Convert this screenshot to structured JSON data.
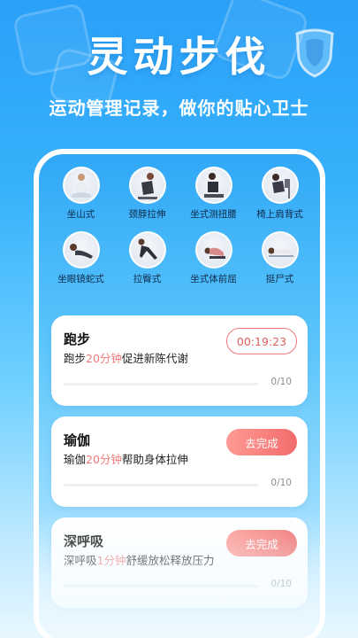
{
  "hero": {
    "title": "灵动步伐",
    "subtitle": "运动管理记录，做你的贴心卫士"
  },
  "poses": [
    {
      "label": "坐山式",
      "icon": "sitting-mountain-pose-icon"
    },
    {
      "label": "颈脖拉伸",
      "icon": "neck-stretch-pose-icon"
    },
    {
      "label": "坐式测扭腰",
      "icon": "seated-twist-pose-icon"
    },
    {
      "label": "椅上肩背式",
      "icon": "chair-shoulder-pose-icon"
    },
    {
      "label": "坐眼镜蛇式",
      "icon": "cobra-pose-icon"
    },
    {
      "label": "拉臀式",
      "icon": "hip-stretch-pose-icon"
    },
    {
      "label": "坐式体前屈",
      "icon": "forward-bend-pose-icon"
    },
    {
      "label": "挺尸式",
      "icon": "corpse-pose-icon"
    }
  ],
  "tasks": [
    {
      "title": "跑步",
      "desc_prefix": "跑步",
      "desc_highlight": "20分钟",
      "desc_suffix": "促进新陈代谢",
      "action_label": "00:19:23",
      "action_type": "timer",
      "progress_text": "0/10",
      "progress_fraction": 0
    },
    {
      "title": "瑜伽",
      "desc_prefix": "瑜伽",
      "desc_highlight": "20分钟",
      "desc_suffix": "帮助身体拉伸",
      "action_label": "去完成",
      "action_type": "button",
      "progress_text": "0/10",
      "progress_fraction": 0
    },
    {
      "title": "深呼吸",
      "desc_prefix": "深呼吸",
      "desc_highlight": "1分钟",
      "desc_suffix": "舒缓放松释放压力",
      "action_label": "去完成",
      "action_type": "button",
      "progress_text": "0/10",
      "progress_fraction": 0
    }
  ],
  "colors": {
    "accent": "#f07a7a",
    "primary_blue": "#2aa0f8"
  }
}
